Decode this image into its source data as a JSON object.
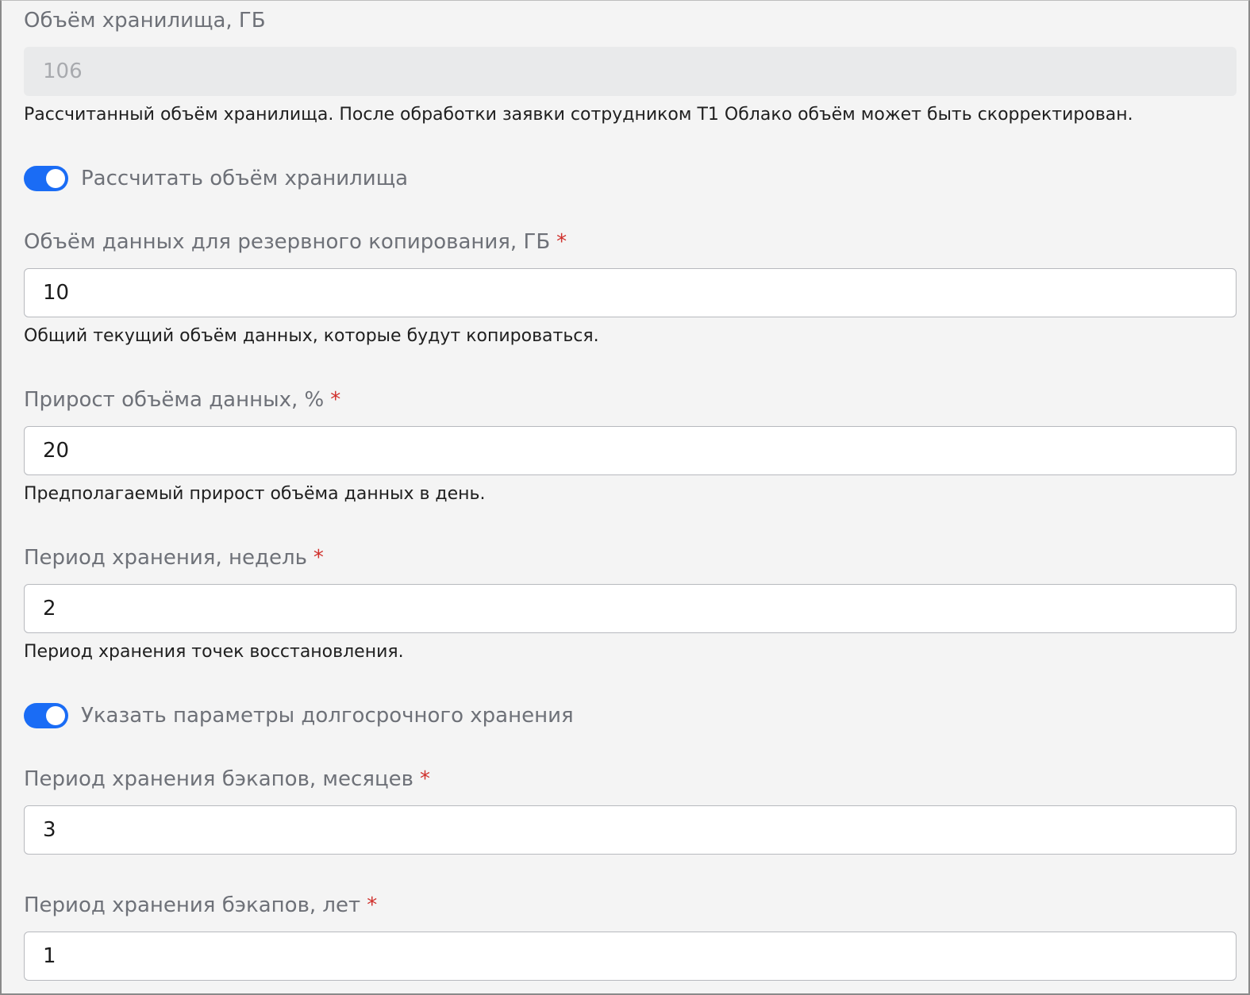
{
  "storage": {
    "label": "Объём хранилища, ГБ",
    "value": "106",
    "hint": "Рассчитанный объём хранилища. После обработки заявки сотрудником Т1 Облако объём может быть скорректирован."
  },
  "calc_toggle": {
    "label": "Рассчитать объём хранилища",
    "on": true
  },
  "backup_volume": {
    "label": "Объём данных для резервного копирования, ГБ",
    "required_mark": "*",
    "value": "10",
    "hint": "Общий текущий объём данных, которые будут копироваться."
  },
  "growth": {
    "label": "Прирост объёма данных, %",
    "required_mark": "*",
    "value": "20",
    "hint": "Предполагаемый прирост объёма данных в день."
  },
  "retention_weeks": {
    "label": "Период хранения, недель",
    "required_mark": "*",
    "value": "2",
    "hint": "Период хранения точек восстановления."
  },
  "longterm_toggle": {
    "label": "Указать параметры долгосрочного хранения",
    "on": true
  },
  "retention_months": {
    "label": "Период хранения бэкапов, месяцев",
    "required_mark": "*",
    "value": "3"
  },
  "retention_years": {
    "label": "Период хранения бэкапов, лет",
    "required_mark": "*",
    "value": "1"
  },
  "colors": {
    "background": "#f4f4f4",
    "toggle_on": "#1a6cf5",
    "required": "#d0312d",
    "label": "#6e7178"
  }
}
